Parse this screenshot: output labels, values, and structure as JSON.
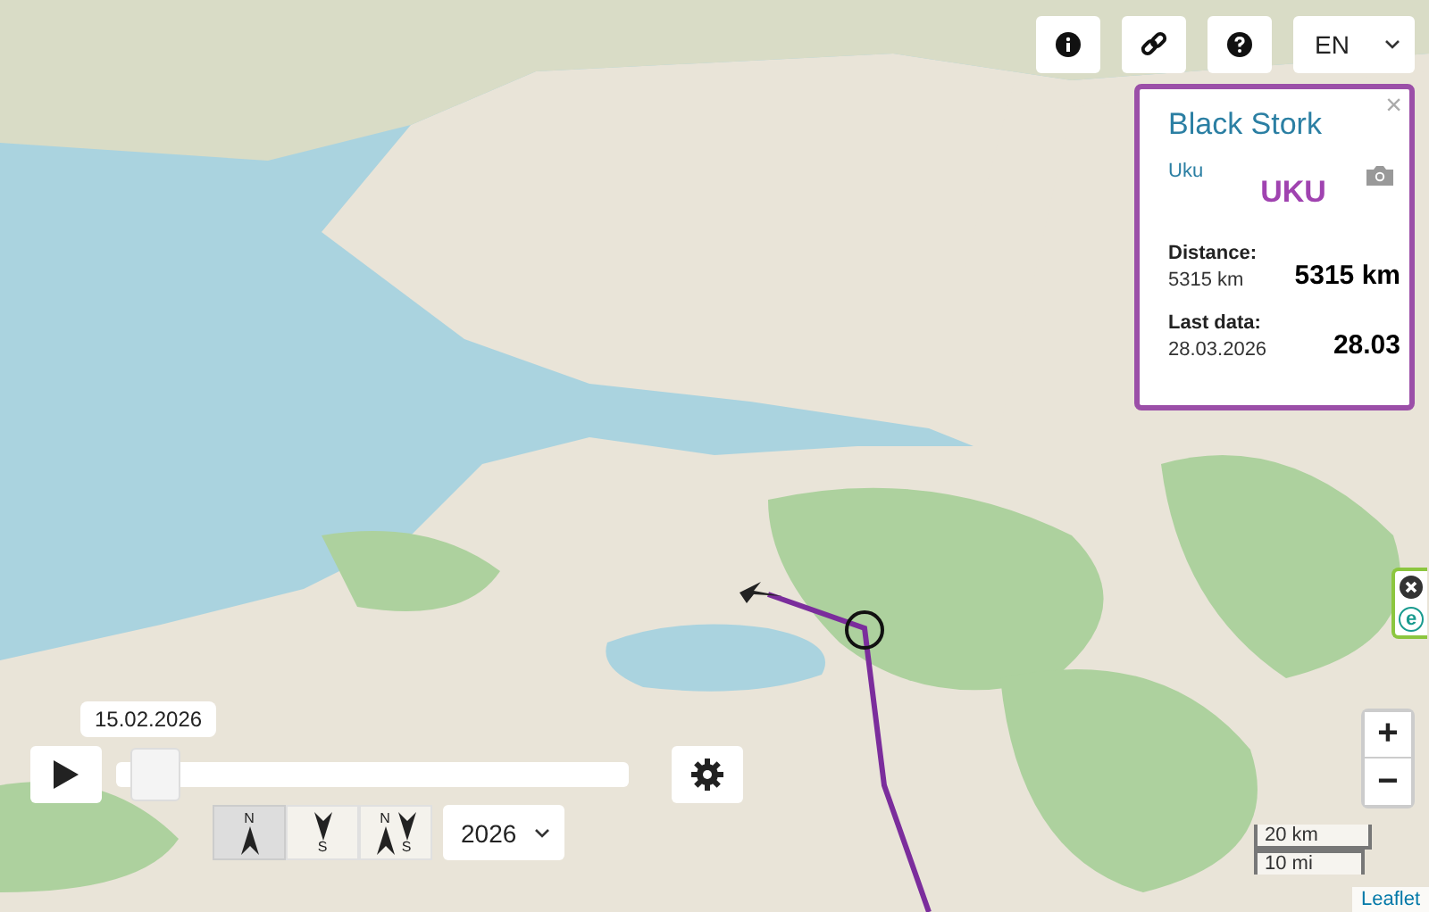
{
  "top_buttons": [
    {
      "kind": "info"
    },
    {
      "kind": "link"
    },
    {
      "kind": "help"
    }
  ],
  "language": {
    "value": "EN"
  },
  "info_panel": {
    "close": "×",
    "title": "Black Stork",
    "name": "Uku",
    "logo": "UKU",
    "distance_label": "Distance:",
    "distance_small": "5315 km",
    "distance_big": "5315 km",
    "last_label": "Last data:",
    "last_small": "28.03.2026",
    "last_big": "28.03"
  },
  "side_plugins": [
    {
      "kind": "close"
    },
    {
      "kind": "logo",
      "label": "e"
    }
  ],
  "player": {
    "date": "15.02.2026",
    "level": 0.03
  },
  "view_modes": [
    {
      "kind": "north",
      "selected": true,
      "letters": [
        "N"
      ]
    },
    {
      "kind": "south",
      "selected": false,
      "letters": [
        "S"
      ]
    },
    {
      "kind": "both",
      "selected": false,
      "letters": [
        "N",
        "S"
      ]
    }
  ],
  "year": {
    "value": "2026"
  },
  "zoom": {
    "in": "+",
    "out": "−"
  },
  "scale": {
    "metric": "20 km",
    "imperial": "10 mi"
  },
  "attribution": "Leaflet"
}
